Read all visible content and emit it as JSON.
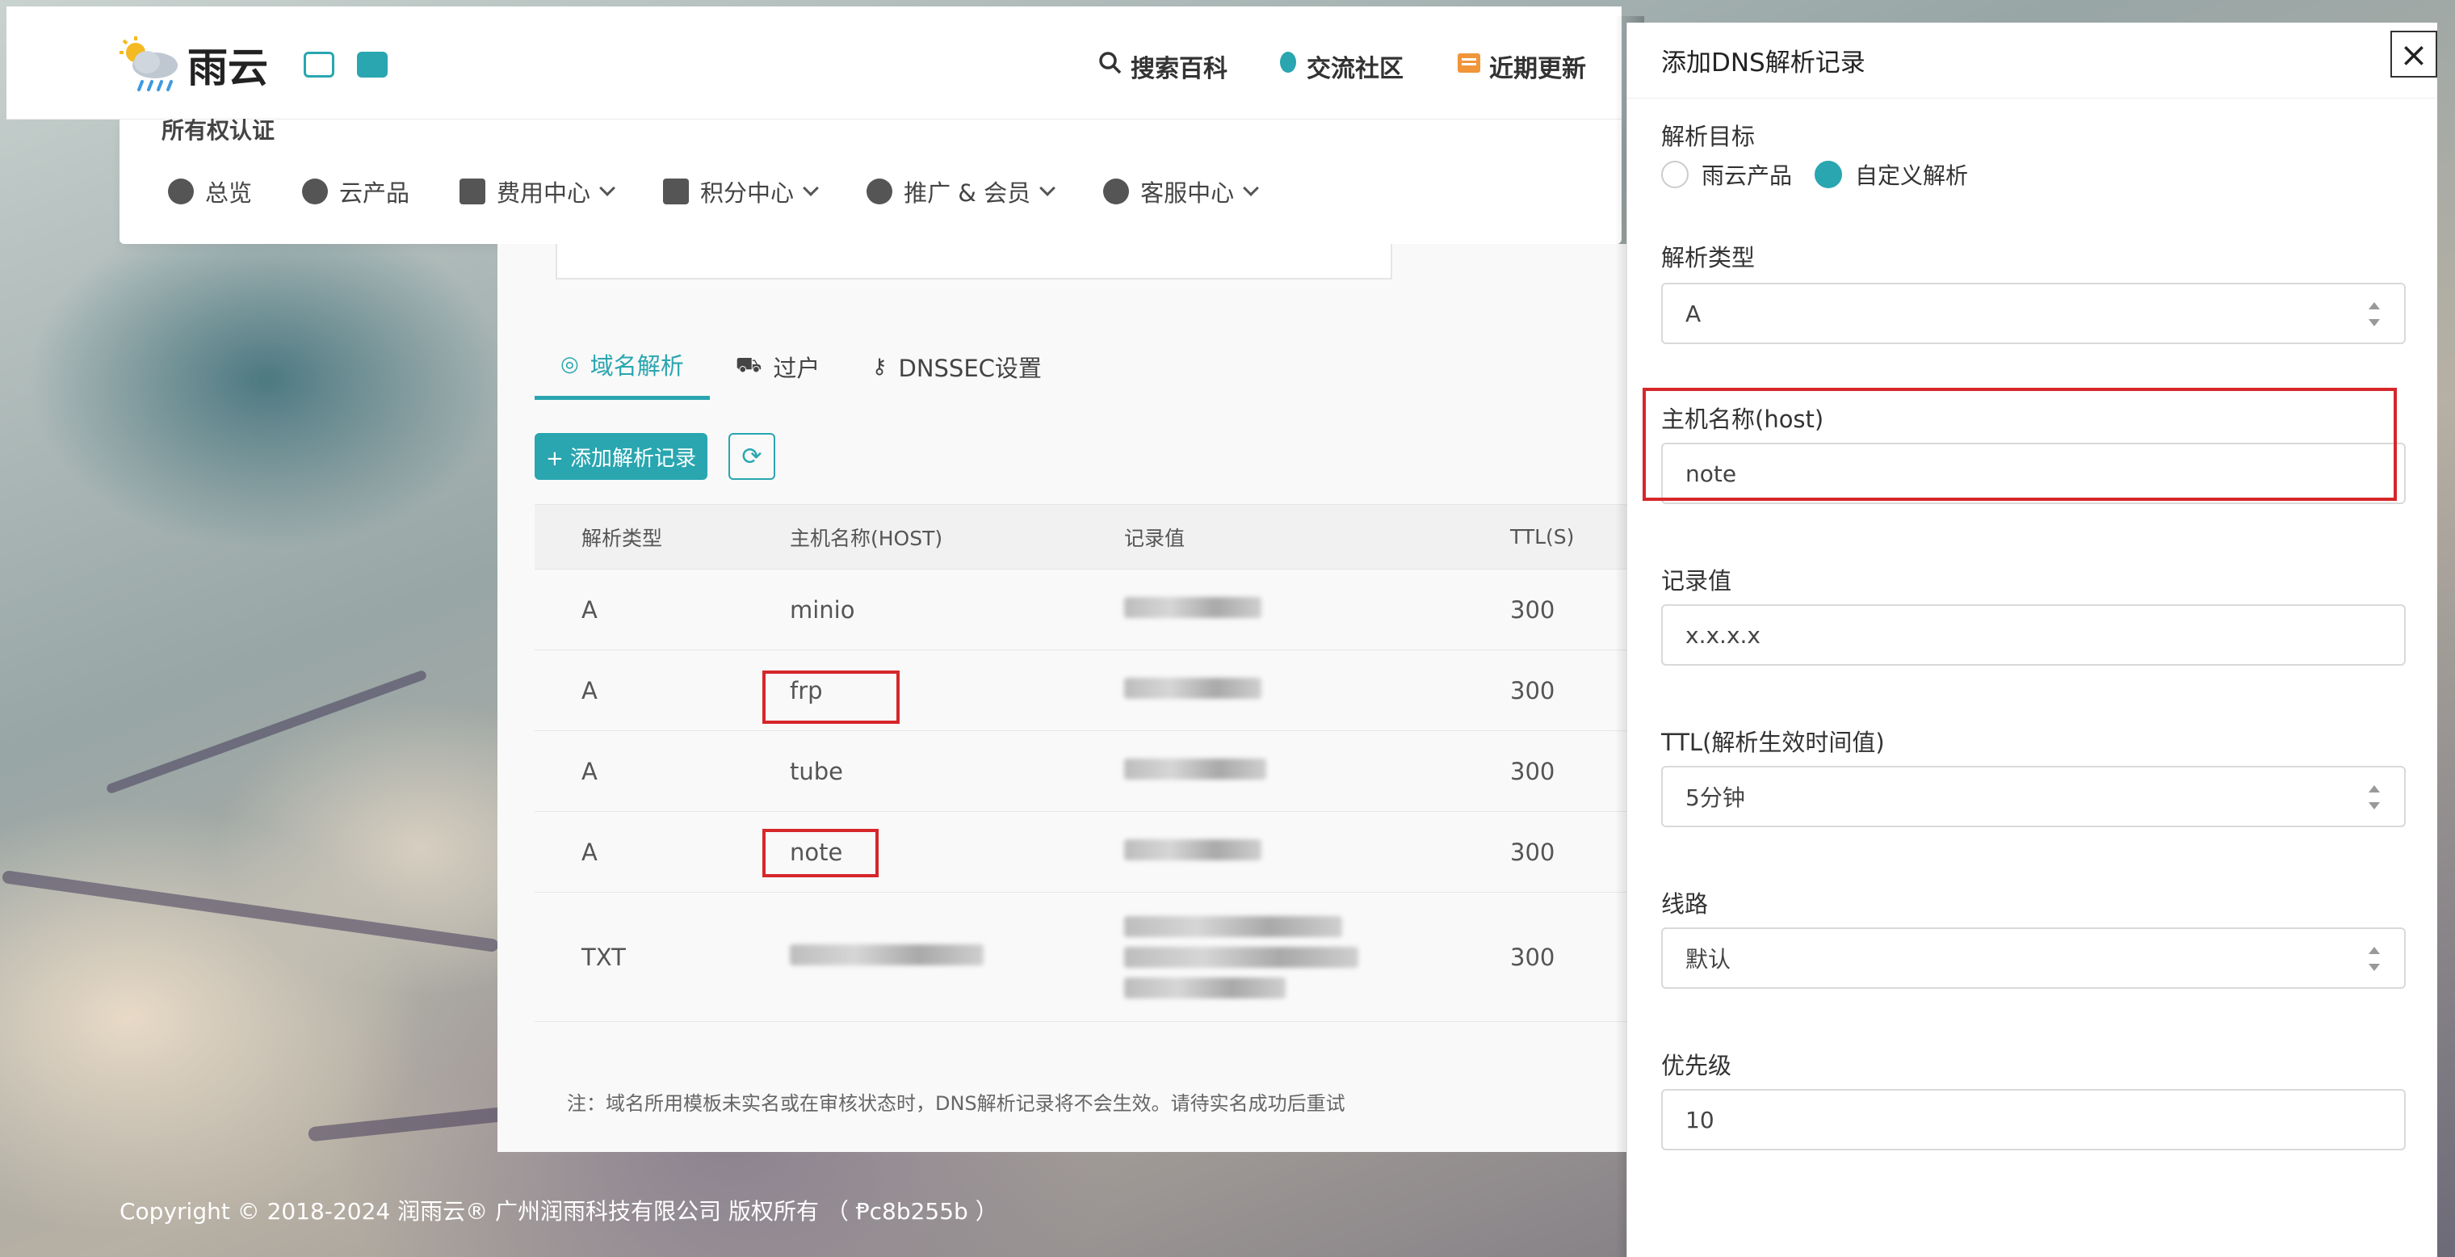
{
  "header": {
    "logo_text": "雨云",
    "nav": [
      {
        "label": "搜索百科",
        "icon": "search-icon"
      },
      {
        "label": "交流社区",
        "icon": "qq-icon"
      },
      {
        "label": "近期更新",
        "icon": "news-icon"
      }
    ]
  },
  "subnav": {
    "peek_label": "所有权认证",
    "items": [
      {
        "label": "总览",
        "icon": "dashboard-icon"
      },
      {
        "label": "云产品",
        "icon": "cubes-icon"
      },
      {
        "label": "费用中心",
        "icon": "money-icon"
      },
      {
        "label": "积分中心",
        "icon": "gift-icon"
      },
      {
        "label": "推广 & 会员",
        "icon": "users-icon"
      },
      {
        "label": "客服中心",
        "icon": "headset-icon"
      }
    ]
  },
  "tabs": [
    {
      "label": "域名解析",
      "icon": "dns-icon",
      "active": true
    },
    {
      "label": "过户",
      "icon": "truck-icon",
      "active": false
    },
    {
      "label": "DNSSEC设置",
      "icon": "key-icon",
      "active": false
    }
  ],
  "toolbar": {
    "add_label": "+ 添加解析记录",
    "refresh_icon": "refresh-icon"
  },
  "table": {
    "headers": [
      "解析类型",
      "主机名称(HOST)",
      "记录值",
      "TTL(S)"
    ],
    "rows": [
      {
        "type": "A",
        "host": "minio",
        "ttl": "300"
      },
      {
        "type": "A",
        "host": "frp",
        "ttl": "300"
      },
      {
        "type": "A",
        "host": "tube",
        "ttl": "300"
      },
      {
        "type": "A",
        "host": "note",
        "ttl": "300"
      },
      {
        "type": "TXT",
        "host": "",
        "ttl": "300"
      }
    ]
  },
  "notice": "注：域名所用模板未实名或在审核状态时，DNS解析记录将不会生效。请待实名成功后重试",
  "footer": {
    "copyright": "Copyright © 2018-2024 润雨云® 广州润雨科技有限公司 版权所有 （ Ᵽc8b255b ）"
  },
  "modal": {
    "title": "添加DNS解析记录",
    "close_icon": "close-icon",
    "target_label": "解析目标",
    "target_options": [
      {
        "label": "雨云产品",
        "selected": false
      },
      {
        "label": "自定义解析",
        "selected": true
      }
    ],
    "type_label": "解析类型",
    "type_value": "A",
    "host_label": "主机名称(host)",
    "host_value": "note",
    "record_label": "记录值",
    "record_value": "x.x.x.x",
    "ttl_label": "TTL(解析生效时间值)",
    "ttl_value": "5分钟",
    "line_label": "线路",
    "line_value": "默认",
    "priority_label": "优先级",
    "priority_value": "10"
  },
  "colors": {
    "accent": "#29a6b0",
    "highlight": "#d6272a"
  }
}
